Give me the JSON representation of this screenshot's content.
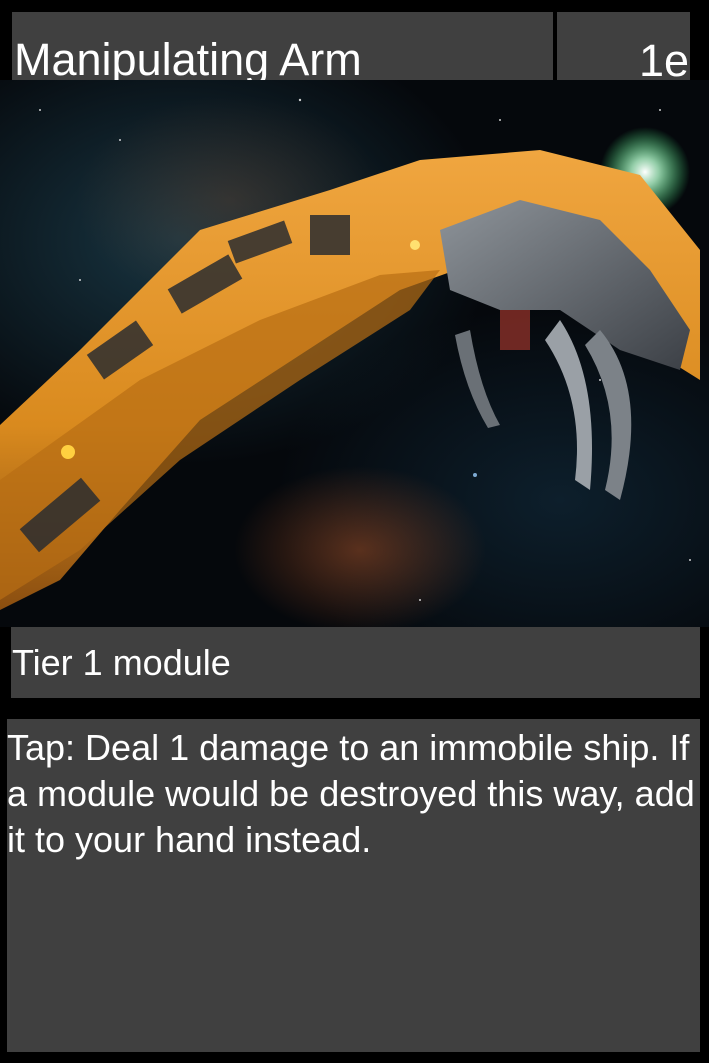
{
  "card": {
    "title": "Manipulating Arm",
    "cost": "1e",
    "type_line": "Tier 1 module",
    "rules_text": "Tap: Deal 1 damage to an immobile ship. If a module would be destroyed this way, add it to your hand instead.",
    "art_description": "",
    "colors": {
      "bar_background": "#404040",
      "text": "#ffffff",
      "card_border": "#000000",
      "arm_orange": "#d98a1e"
    }
  }
}
